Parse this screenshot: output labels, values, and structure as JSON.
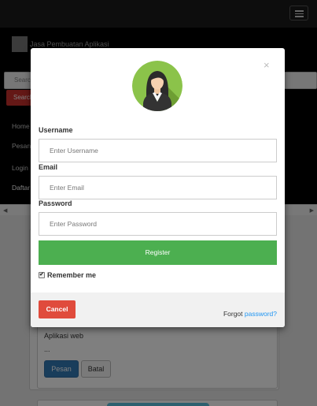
{
  "page": {
    "brand": "Jasa Pembuatan Aplikasi",
    "search_placeholder": "Search",
    "search_button": "Search",
    "nav": [
      "Home",
      "Pesan",
      "Login",
      "Daftar"
    ],
    "card": {
      "title": "Aplikasi web",
      "text": "...",
      "pesan_button": "Pesan",
      "batal_button": "Batal"
    }
  },
  "modal": {
    "close_glyph": "×",
    "username_label": "Username",
    "username_placeholder": "Enter Username",
    "email_label": "Email",
    "email_placeholder": "Enter Email",
    "password_label": "Password",
    "password_placeholder": "Enter Password",
    "register_button": "Register",
    "remember_label": "Remember me",
    "remember_checked": true,
    "cancel_button": "Cancel",
    "forgot_text": "Forgot",
    "forgot_link": "password?"
  },
  "colors": {
    "register_green": "#4caf50",
    "cancel_red": "#e04b3c",
    "link_blue": "#2196f3",
    "avatar_green": "#8bc34a"
  }
}
